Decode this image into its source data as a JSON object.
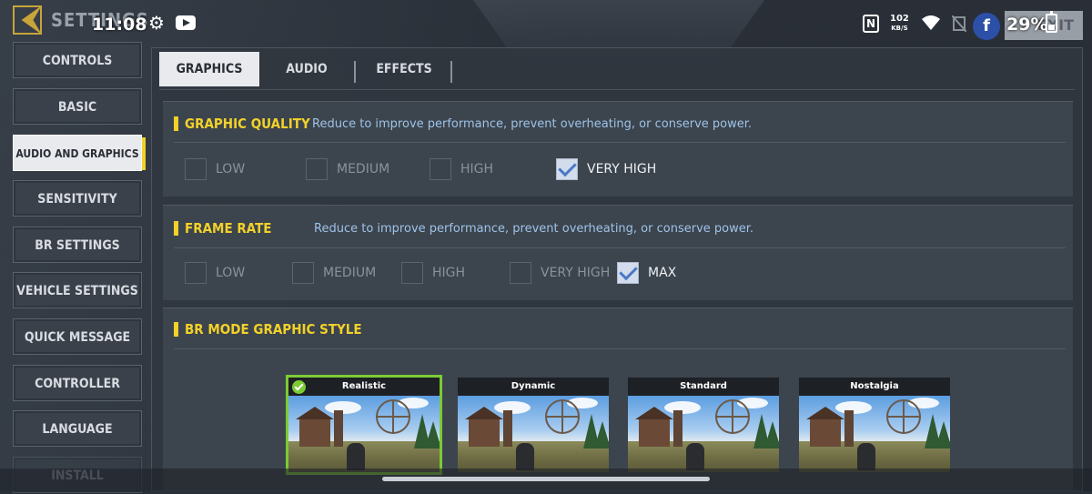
{
  "status_bar": {
    "time": "11:08",
    "net_speed_value": "102",
    "net_speed_unit": "KB/S",
    "battery": "29%"
  },
  "header": {
    "title": "SETTINGS",
    "exit_label": "EXIT"
  },
  "sidebar": {
    "items": [
      {
        "label": "CONTROLS"
      },
      {
        "label": "BASIC"
      },
      {
        "label": "AUDIO AND GRAPHICS",
        "active": true
      },
      {
        "label": "SENSITIVITY"
      },
      {
        "label": "BR SETTINGS"
      },
      {
        "label": "VEHICLE SETTINGS"
      },
      {
        "label": "QUICK MESSAGE"
      },
      {
        "label": "CONTROLLER"
      },
      {
        "label": "LANGUAGE"
      },
      {
        "label": "INSTALL"
      }
    ]
  },
  "tabs": [
    {
      "label": "GRAPHICS",
      "active": true
    },
    {
      "label": "AUDIO"
    },
    {
      "label": "EFFECTS"
    }
  ],
  "graphic_quality": {
    "title": "GRAPHIC QUALITY",
    "description": "Reduce to improve performance, prevent overheating, or conserve power.",
    "options": [
      {
        "label": "LOW",
        "checked": false
      },
      {
        "label": "MEDIUM",
        "checked": false
      },
      {
        "label": "HIGH",
        "checked": false
      },
      {
        "label": "VERY HIGH",
        "checked": true
      }
    ]
  },
  "frame_rate": {
    "title": "FRAME RATE",
    "description": "Reduce to improve performance, prevent overheating, or conserve power.",
    "options": [
      {
        "label": "LOW",
        "checked": false
      },
      {
        "label": "MEDIUM",
        "checked": false
      },
      {
        "label": "HIGH",
        "checked": false
      },
      {
        "label": "VERY HIGH",
        "checked": false
      },
      {
        "label": "MAX",
        "checked": true
      }
    ]
  },
  "br_style": {
    "title": "BR MODE GRAPHIC STYLE",
    "cards": [
      {
        "label": "Realistic",
        "selected": true
      },
      {
        "label": "Dynamic",
        "selected": false
      },
      {
        "label": "Standard",
        "selected": false
      },
      {
        "label": "Nostalgia",
        "selected": false
      }
    ]
  },
  "colors": {
    "accent_yellow": "#f2d12a",
    "selected_green": "#7ccb35",
    "description_blue": "#9ec3e8"
  }
}
